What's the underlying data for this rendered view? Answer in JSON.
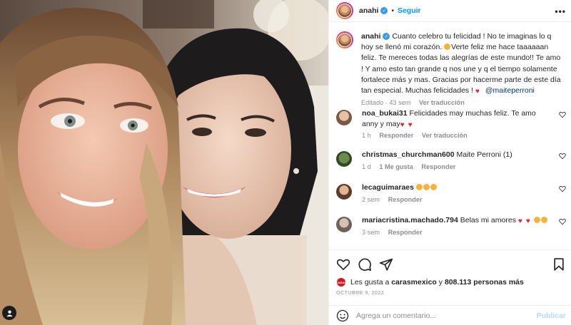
{
  "post": {
    "username": "anahi",
    "follow_label": "Seguir",
    "separator": "•",
    "more_label": "•••"
  },
  "caption": {
    "username": "anahi",
    "text_1": "Cuanto celebro tu felicidad ! No te imaginas lo q hoy se llenó mi corazón.",
    "text_2": "Verte feliz me hace taaaaaan feliz. Te mereces todas las alegrías de este mundo!! Te amo ! Y amo esto tan grande q nos une y q el tiempo solamente fortalece más y mas. Gracias por hacerme parte de este día tan especial. Muchas felicidades !",
    "mention": "@maiteperroni",
    "meta_edited": "Editado · 43 sem",
    "see_translation": "Ver traducción"
  },
  "comments": [
    {
      "username": "noa_bukai31",
      "text": "Felicidades may muchas feliz. Te amo anny y may",
      "time": "1 h",
      "reply": "Responder",
      "translate": "Ver traducción",
      "avatar_color": "#c79b7c"
    },
    {
      "username": "christmas_churchman600",
      "text": "Maite Perroni (1)",
      "time": "1 d",
      "likes": "1 Me gusta",
      "reply": "Responder",
      "avatar_color": "#4f6a3a"
    },
    {
      "username": "lecaguimaraes",
      "text": "",
      "time": "2 sem",
      "reply": "Responder",
      "avatar_color": "#9c6a4d"
    },
    {
      "username": "mariacristina.machado.794",
      "text": "Belas mi amores",
      "time": "3 sem",
      "reply": "Responder",
      "avatar_color": "#8a7d73"
    }
  ],
  "likes": {
    "badge": "CARAS",
    "prefix": "Les gusta a",
    "user": "carasmexico",
    "joiner": "y",
    "count": "808.113 personas más"
  },
  "date": "OCTUBRE 9, 2022",
  "add_comment": {
    "placeholder": "Agrega un comentario...",
    "publish_label": "Publicar"
  },
  "colors": {
    "accent": "#0095f6",
    "verified": "#3897f0",
    "muted": "#8e8e8e",
    "heart": "#e0243a"
  },
  "icons": [
    "user-tag-icon",
    "verified-icon",
    "more-options-icon",
    "heart-icon",
    "comment-icon",
    "share-icon",
    "bookmark-icon",
    "emoji-icon"
  ]
}
